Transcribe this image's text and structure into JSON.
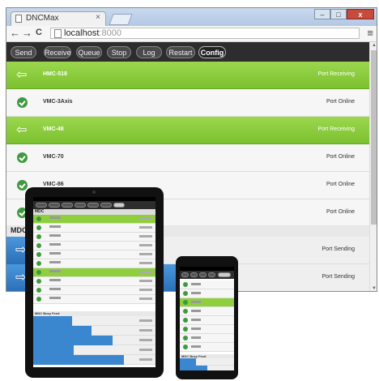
{
  "window": {
    "tab_title": "DNCMax",
    "tab_close": "×",
    "min_label": "–",
    "max_label": "□",
    "close_label": "x"
  },
  "nav": {
    "back": "←",
    "forward": "→",
    "reload": "C",
    "url_host": "localhost",
    "url_port": ":8000",
    "menu": "≡"
  },
  "toolbar": {
    "buttons": [
      "Send",
      "Receive",
      "Queue",
      "Stop",
      "Log",
      "Restart",
      "Config"
    ],
    "active": "Config"
  },
  "ports": [
    {
      "name": "HMC-518",
      "status": "Port Receiving",
      "state": "receiving"
    },
    {
      "name": "VMC-3Axis",
      "status": "Port Online",
      "state": "online"
    },
    {
      "name": "VMC-48",
      "status": "Port Receiving",
      "state": "receiving"
    },
    {
      "name": "VMC-70",
      "status": "Port Online",
      "state": "online"
    },
    {
      "name": "VMC-86",
      "status": "Port Online",
      "state": "online"
    },
    {
      "name": "",
      "status": "Port Online",
      "state": "online"
    }
  ],
  "mdc_section": {
    "header": "MDC D"
  },
  "sending_rows": [
    {
      "status": "Port Sending",
      "progress": 0.1
    },
    {
      "status": "Port Sending",
      "progress": 0.47
    }
  ],
  "colors": {
    "receiving": "#7cc12f",
    "online_dot": "#3f9a3f",
    "sending_bar": "#2a6fb7",
    "toolbar": "#2d2d2d"
  },
  "devices": {
    "tablet": {
      "mdc_header": "MDC",
      "mdc_busy_header": "MDC Busy Feed"
    },
    "phone": {
      "mdc_busy_header": "MDC Busy Feed"
    }
  }
}
